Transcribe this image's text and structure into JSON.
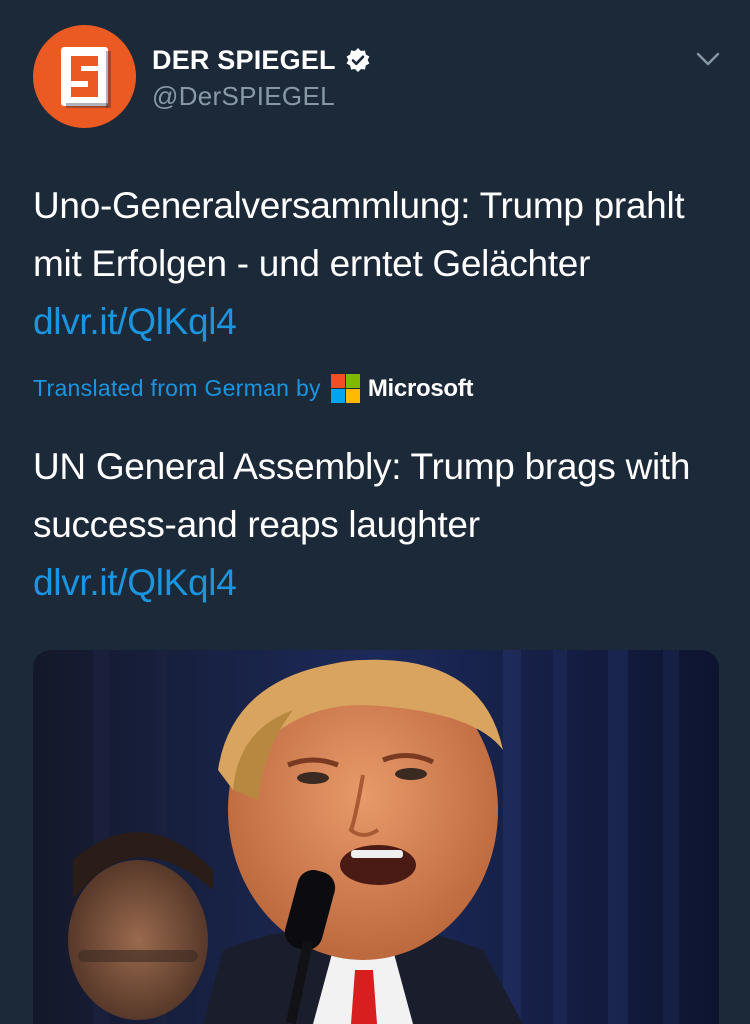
{
  "tweet": {
    "display_name": "DER SPIEGEL",
    "handle": "@DerSPIEGEL",
    "avatar_letter": "S",
    "original_text": "Uno-Generalversammlung: Trump prahlt mit Erfolgen - und erntet Gelächter",
    "original_link": "dlvr.it/QlKql4",
    "translation_label": "Translated from German by",
    "translator": "Microsoft",
    "translated_text": "UN General Assembly: Trump brags with success-and reaps laughter",
    "translated_link": "dlvr.it/QlKql4"
  },
  "icons": {
    "verified": "verified-badge-icon",
    "menu": "chevron-down-icon",
    "translator_logo": "microsoft-logo-icon"
  },
  "colors": {
    "background": "#1c2938",
    "link": "#1b95e0",
    "handle": "#8899a6",
    "avatar": "#ec5a23",
    "ms_red": "#f25022",
    "ms_green": "#7fba00",
    "ms_blue": "#00a4ef",
    "ms_yellow": "#ffb900"
  }
}
